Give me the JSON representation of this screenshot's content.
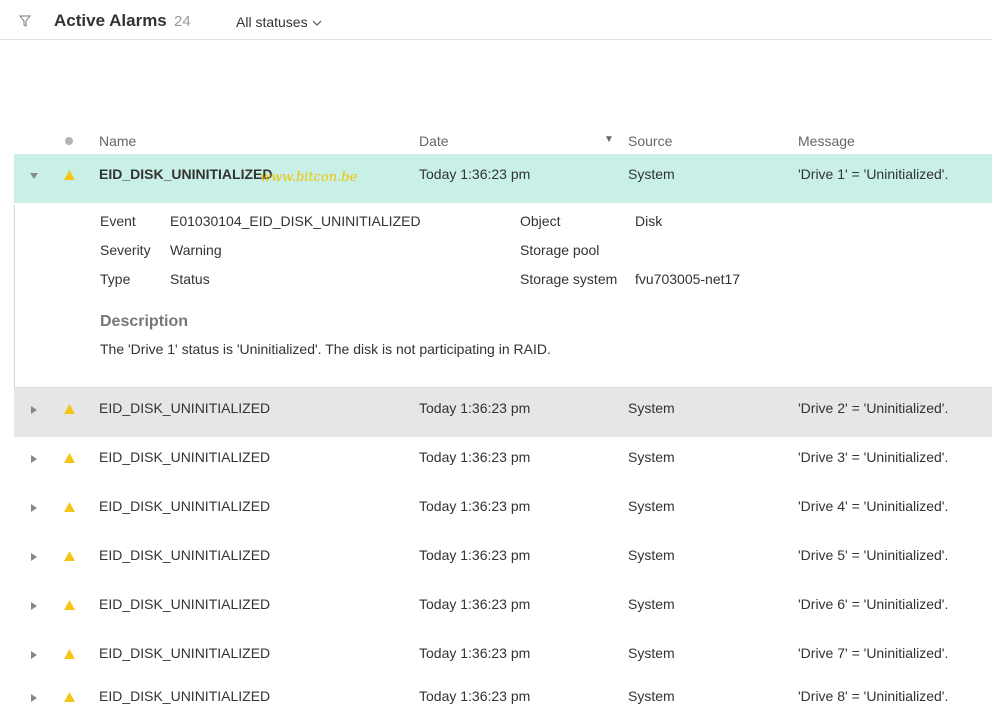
{
  "topbar": {
    "title": "Active Alarms",
    "count": "24",
    "status_filter": "All statuses"
  },
  "columns": {
    "name": "Name",
    "date": "Date",
    "source": "Source",
    "message": "Message"
  },
  "rows": [
    {
      "name": "EID_DISK_UNINITIALIZED",
      "date": "Today 1:36:23 pm",
      "source": "System",
      "message": "'Drive 1' = 'Uninitialized'.",
      "state": "expanded"
    },
    {
      "name": "EID_DISK_UNINITIALIZED",
      "date": "Today 1:36:23 pm",
      "source": "System",
      "message": "'Drive 2' = 'Uninitialized'.",
      "state": "hover"
    },
    {
      "name": "EID_DISK_UNINITIALIZED",
      "date": "Today 1:36:23 pm",
      "source": "System",
      "message": "'Drive 3' = 'Uninitialized'."
    },
    {
      "name": "EID_DISK_UNINITIALIZED",
      "date": "Today 1:36:23 pm",
      "source": "System",
      "message": "'Drive 4' = 'Uninitialized'."
    },
    {
      "name": "EID_DISK_UNINITIALIZED",
      "date": "Today 1:36:23 pm",
      "source": "System",
      "message": "'Drive 5' = 'Uninitialized'."
    },
    {
      "name": "EID_DISK_UNINITIALIZED",
      "date": "Today 1:36:23 pm",
      "source": "System",
      "message": "'Drive 6' = 'Uninitialized'."
    },
    {
      "name": "EID_DISK_UNINITIALIZED",
      "date": "Today 1:36:23 pm",
      "source": "System",
      "message": "'Drive 7' = 'Uninitialized'."
    },
    {
      "name": "EID_DISK_UNINITIALIZED",
      "date": "Today 1:36:23 pm",
      "source": "System",
      "message": "'Drive 8' = 'Uninitialized'."
    }
  ],
  "details": {
    "event_label": "Event",
    "event_value": "E01030104_EID_DISK_UNINITIALIZED",
    "severity_label": "Severity",
    "severity_value": "Warning",
    "type_label": "Type",
    "type_value": "Status",
    "object_label": "Object",
    "object_value": "Disk",
    "pool_label": "Storage pool",
    "pool_value": "",
    "system_label": "Storage system",
    "system_value": "fvu703005-net17",
    "description_title": "Description",
    "description_text": "The 'Drive 1' status is 'Uninitialized'. The disk is not participating in RAID."
  },
  "watermark": "www.bitcon.be",
  "colors": {
    "selected_row": "#c8f0e6",
    "hover_row": "#e6e6e6",
    "warning": "#f5c518"
  }
}
